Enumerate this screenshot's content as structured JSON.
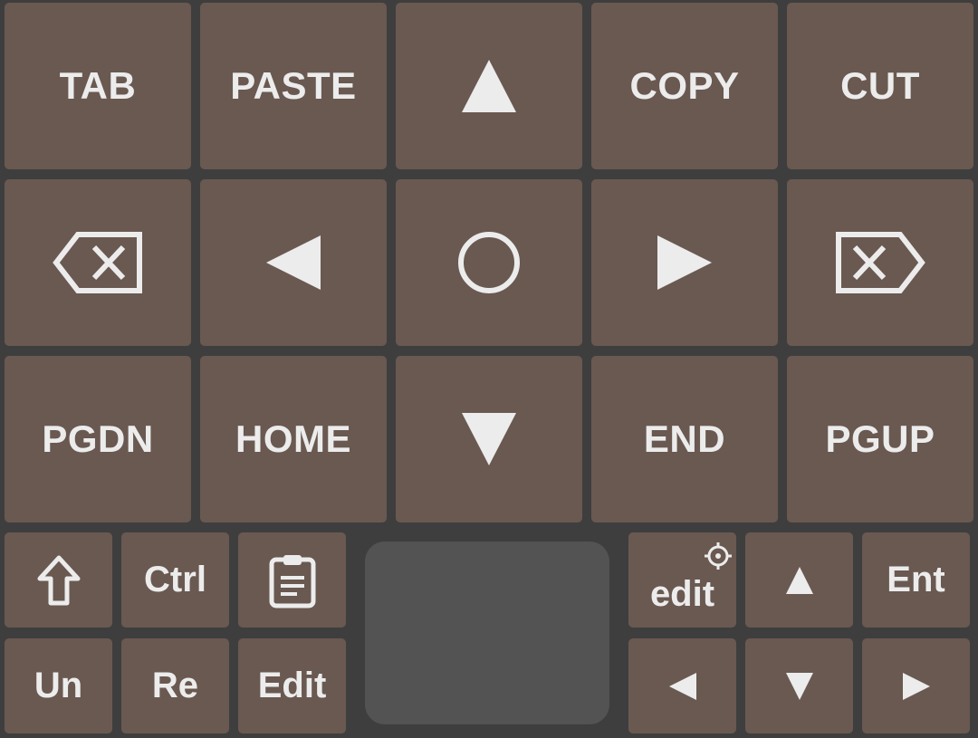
{
  "colors": {
    "background": "#3e3e3e",
    "key": "#6a5951",
    "text": "#ececec",
    "trackpad": "#535353"
  },
  "large_keys": {
    "tab": "TAB",
    "paste": "PASTE",
    "arrow_up": "up-triangle-icon",
    "copy": "COPY",
    "cut": "CUT",
    "backspace": "backspace-icon",
    "arrow_left": "left-triangle-icon",
    "center": "circle-icon",
    "arrow_right": "right-triangle-icon",
    "delete": "delete-icon",
    "pgdn": "PGDN",
    "home": "HOME",
    "arrow_down": "down-triangle-icon",
    "end": "END",
    "pgup": "PGUP"
  },
  "small_keys": {
    "shift": "shift-arrow-icon",
    "ctrl": "Ctrl",
    "clipboard": "clipboard-icon",
    "edit_mode": "edit",
    "edit_mode_icon": "gear-icon",
    "up": "up-triangle-icon",
    "enter": "Ent",
    "undo": "Un",
    "redo": "Re",
    "edit": "Edit",
    "left": "left-triangle-icon",
    "down": "down-triangle-icon",
    "right": "right-triangle-icon"
  }
}
